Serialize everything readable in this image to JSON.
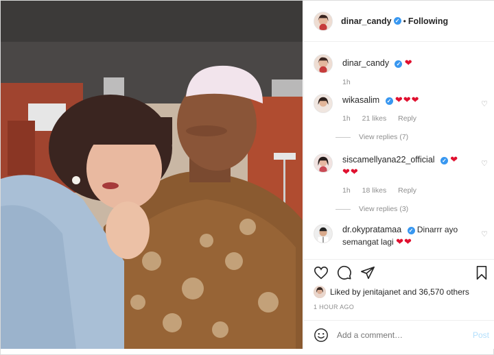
{
  "post": {
    "author": "dinar_candy",
    "follow_status": "Following",
    "separator": "•"
  },
  "caption": {
    "username": "dinar_candy",
    "hearts": "❤",
    "time": "1h"
  },
  "comments": [
    {
      "username": "wikasalim",
      "text": "❤❤❤",
      "time": "1h",
      "likes": "21 likes",
      "reply": "Reply",
      "view_replies": "View replies (7)"
    },
    {
      "username": "siscamellyana22_official",
      "text_line1": "❤",
      "text_line2": "❤❤",
      "time": "1h",
      "likes": "18 likes",
      "reply": "Reply",
      "view_replies": "View replies (3)"
    },
    {
      "username": "dr.okypratamaa",
      "text_line1": "Dinarrr ayo",
      "text_line2": "semangat lagi",
      "hearts": "❤❤"
    }
  ],
  "likes": {
    "prefix": "Liked by",
    "first_liker": "jenitajanet",
    "and": "and",
    "count": "36,570 others"
  },
  "timestamp": "1 HOUR AGO",
  "add_comment": {
    "placeholder": "Add a comment…",
    "post_label": "Post"
  },
  "colors": {
    "heart": "#e0102f",
    "verified": "#3897f0",
    "muted": "#8e8e8e",
    "post_disabled": "#b2dffc"
  },
  "icons": [
    "heart-icon",
    "comment-icon",
    "share-icon",
    "bookmark-icon",
    "emoji-icon",
    "verified-badge-icon"
  ]
}
